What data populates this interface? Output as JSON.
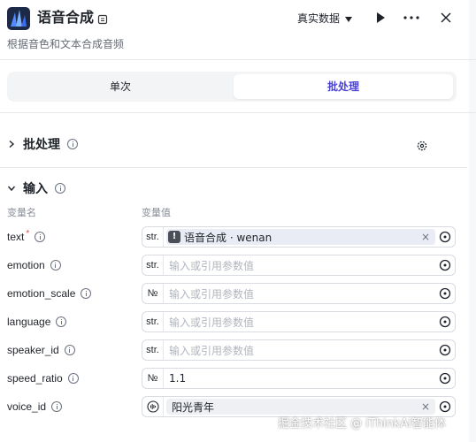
{
  "header": {
    "title": "语音合成",
    "subtitle": "根据音色和文本合成音频",
    "data_select": "真实数据"
  },
  "tabs": [
    {
      "label": "单次",
      "active": false
    },
    {
      "label": "批处理",
      "active": true
    }
  ],
  "batch_section": {
    "label": "批处理"
  },
  "input_section": {
    "label": "输入",
    "col_name": "变量名",
    "col_value": "变量值"
  },
  "fields": [
    {
      "name": "text",
      "required": true,
      "type": "str.",
      "mode": "reference",
      "ref_icon": "!",
      "value": "语音合成 · wenan",
      "clear": "×"
    },
    {
      "name": "emotion",
      "required": false,
      "type": "str.",
      "mode": "empty",
      "placeholder": "输入或引用参数值"
    },
    {
      "name": "emotion_scale",
      "required": false,
      "type": "№",
      "mode": "empty",
      "placeholder": "输入或引用参数值"
    },
    {
      "name": "language",
      "required": false,
      "type": "str.",
      "mode": "empty",
      "placeholder": "输入或引用参数值"
    },
    {
      "name": "speaker_id",
      "required": false,
      "type": "str.",
      "mode": "empty",
      "placeholder": "输入或引用参数值"
    },
    {
      "name": "speed_ratio",
      "required": false,
      "type": "№",
      "mode": "value",
      "value": "1.1"
    },
    {
      "name": "voice_id",
      "required": false,
      "type": "voice",
      "mode": "reference",
      "value": "阳光青年",
      "clear": "×"
    }
  ],
  "required_mark": "*",
  "watermark": "掘金技术社区 @ iThinkAi智能体",
  "colors": {
    "accent": "#4b43d8",
    "required": "#e5484d",
    "logo_bg": "#1c2a48"
  }
}
